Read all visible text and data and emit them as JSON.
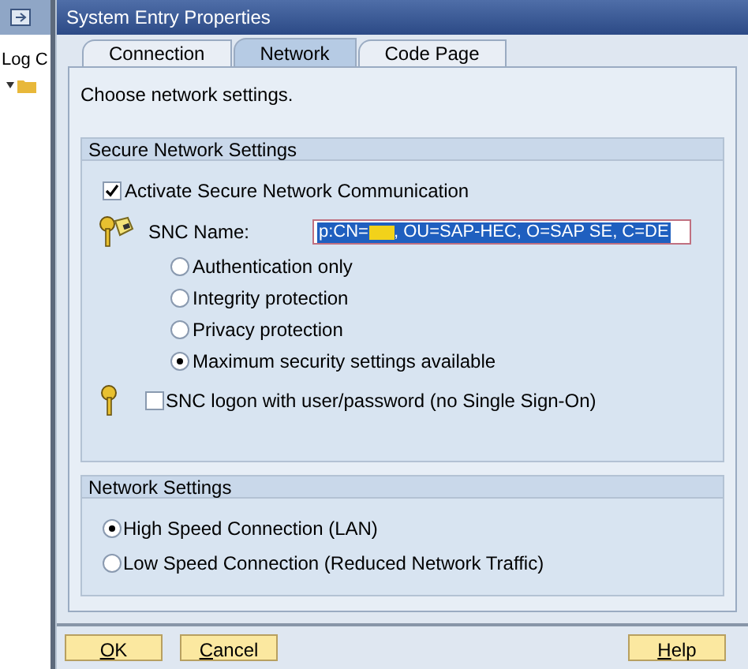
{
  "background_app": {
    "column_header": "Log C"
  },
  "window": {
    "title": "System Entry Properties"
  },
  "tabs": [
    {
      "label": "Connection",
      "selected": false
    },
    {
      "label": "Network",
      "selected": true
    },
    {
      "label": "Code Page",
      "selected": false
    }
  ],
  "intro": "Choose network settings.",
  "secure_group": {
    "title": "Secure Network Settings",
    "activate": {
      "label": "Activate Secure Network Communication",
      "checked": true
    },
    "snc_name": {
      "label": "SNC Name:",
      "value_before": "p:CN=",
      "redacted": true,
      "value_after": ", OU=SAP-HEC, O=SAP SE, C=DE"
    },
    "protection_options": [
      {
        "label": "Authentication only",
        "selected": false
      },
      {
        "label": "Integrity protection",
        "selected": false
      },
      {
        "label": "Privacy protection",
        "selected": false
      },
      {
        "label": "Maximum security settings available",
        "selected": true
      }
    ],
    "snc_logon": {
      "label": "SNC logon with user/password (no Single Sign-On)",
      "checked": false
    }
  },
  "network_group": {
    "title": "Network Settings",
    "options": [
      {
        "label": "High Speed Connection (LAN)",
        "selected": true
      },
      {
        "label": "Low Speed Connection (Reduced Network Traffic)",
        "selected": false
      }
    ]
  },
  "buttons": [
    {
      "label": "OK",
      "kind": "left"
    },
    {
      "label": "Cancel",
      "kind": "left"
    },
    {
      "label": "Help",
      "kind": "right"
    }
  ]
}
